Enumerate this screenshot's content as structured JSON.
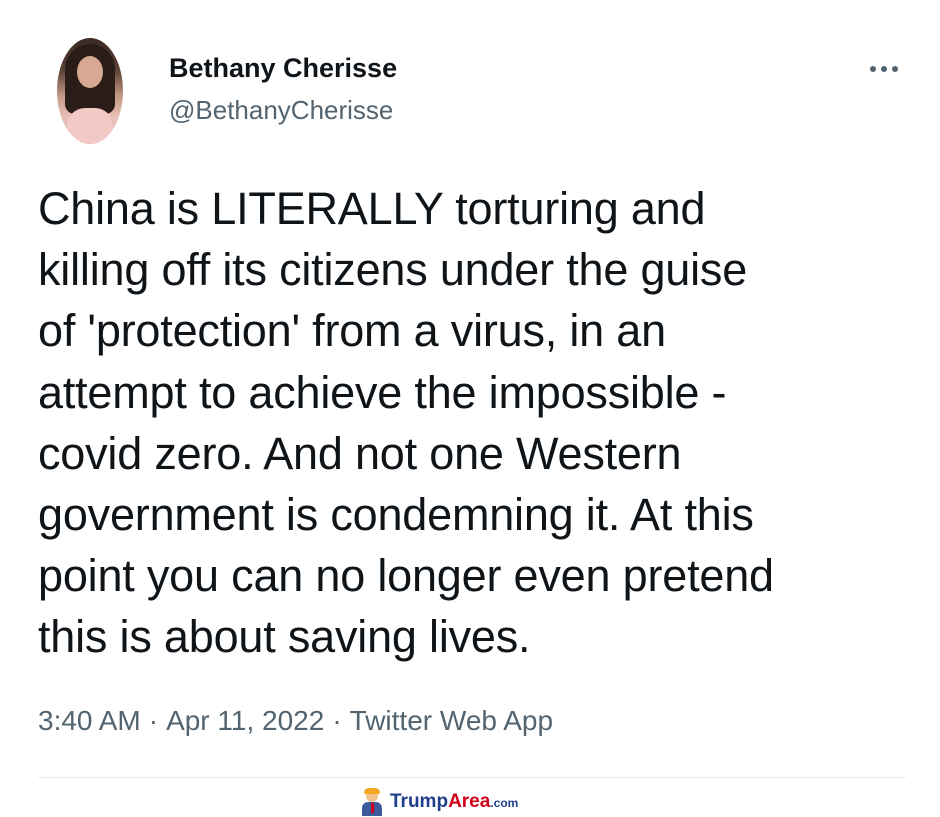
{
  "tweet": {
    "author": {
      "display_name": "Bethany Cherisse",
      "handle": "@BethanyCherisse"
    },
    "text": "China is LITERALLY torturing and\nkilling off its citizens under the guise\nof 'protection' from a virus, in an\nattempt to achieve the impossible -\ncovid zero. And not one Western\ngovernment is condemning it. At this\npoint you can no longer even pretend\nthis is about saving lives.",
    "time": "3:40 AM",
    "separator": "·",
    "date": "Apr 11, 2022",
    "source": "Twitter Web App",
    "more_icon": "more-horizontal-icon"
  },
  "watermark": {
    "brand_part1": "Trump",
    "brand_part2": "Area",
    "suffix": ".com"
  },
  "colors": {
    "text_primary": "#0f1419",
    "text_secondary": "#536471",
    "divider": "#e7ebee",
    "watermark_blue": "#1f3f8a",
    "watermark_red": "#d0021b"
  }
}
